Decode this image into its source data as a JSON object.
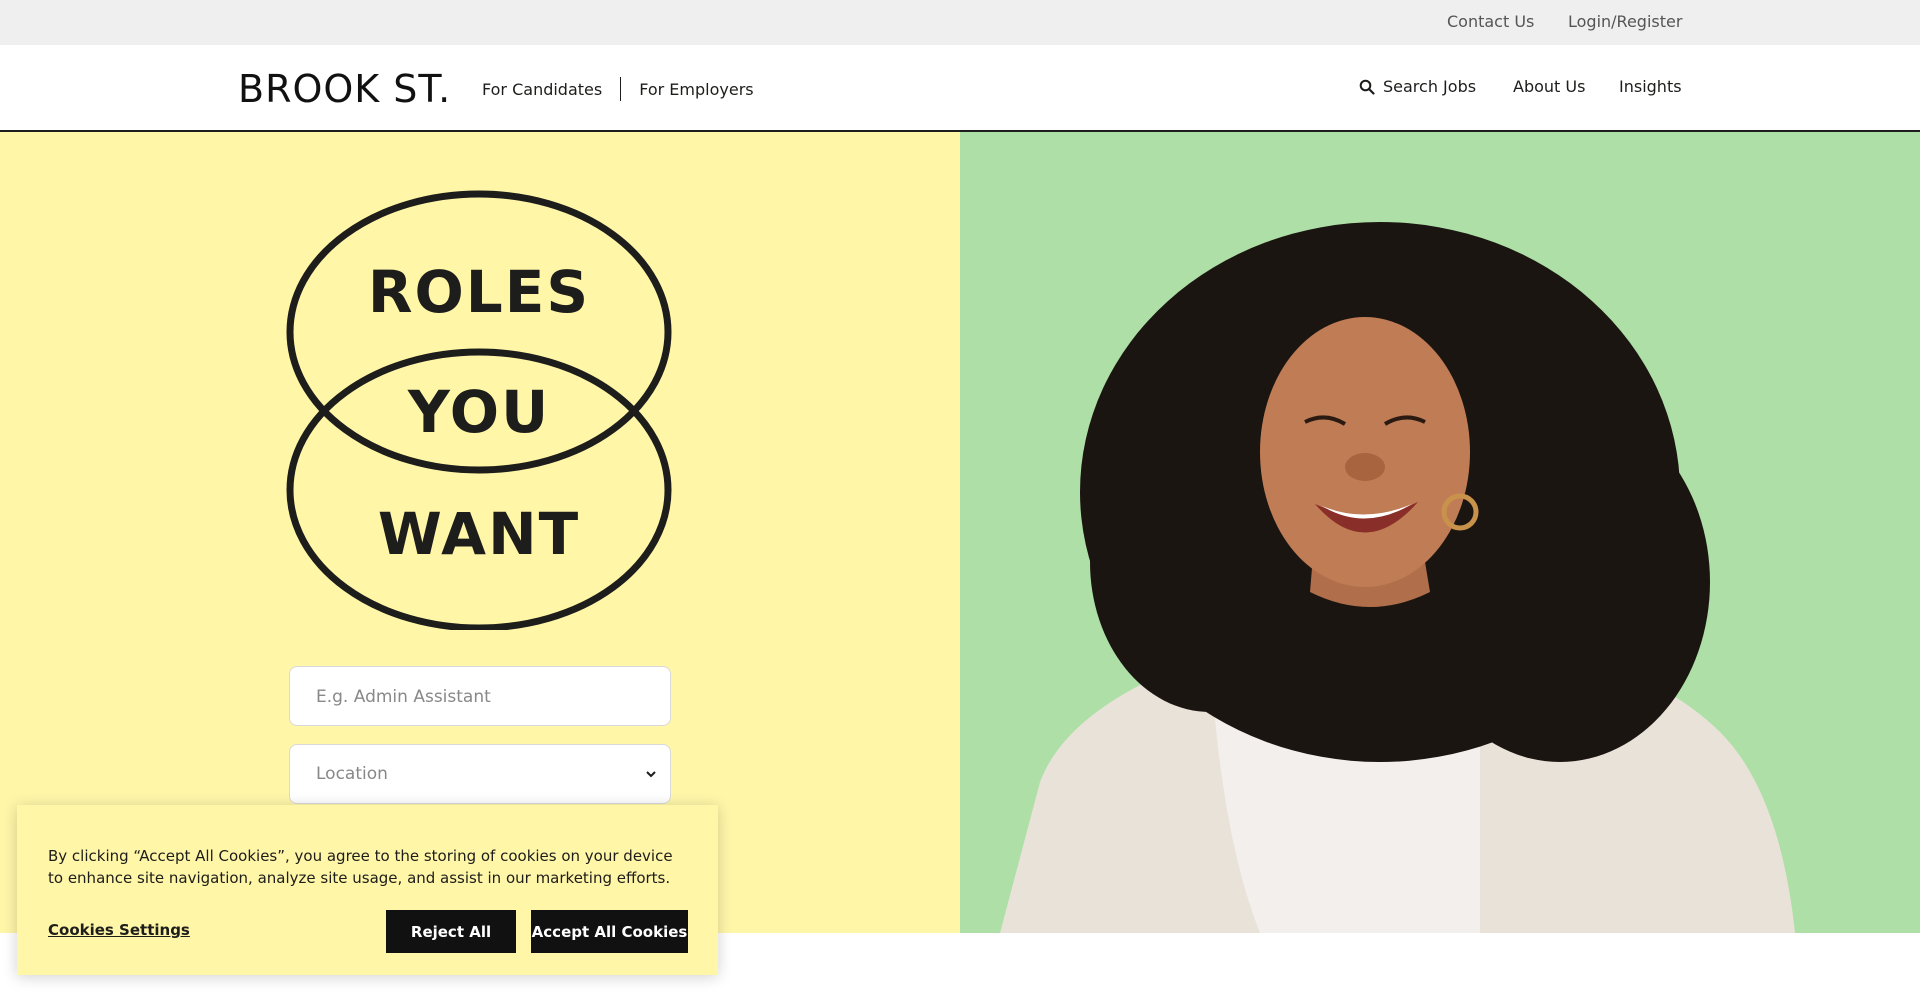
{
  "topbar": {
    "contact": "Contact Us",
    "login": "Login/Register"
  },
  "nav": {
    "logo": "BROOK ST.",
    "for_candidates": "For Candidates",
    "for_employers": "For Employers",
    "search_jobs": "Search Jobs",
    "about": "About Us",
    "insights": "Insights"
  },
  "hero": {
    "headline": [
      "ROLES",
      "YOU",
      "WANT"
    ],
    "keyword_placeholder": "E.g. Admin Assistant",
    "location_placeholder": "Location"
  },
  "cookie": {
    "message": "By clicking “Accept All Cookies”, you agree to the storing of cookies on your device to enhance site navigation, analyze site usage, and assist in our marketing efforts.",
    "settings": "Cookies Settings",
    "reject": "Reject All",
    "accept": "Accept All Cookies"
  },
  "colors": {
    "yellow": "#fff6a8",
    "green": "#addfa6",
    "dark": "#1d1d1b"
  }
}
